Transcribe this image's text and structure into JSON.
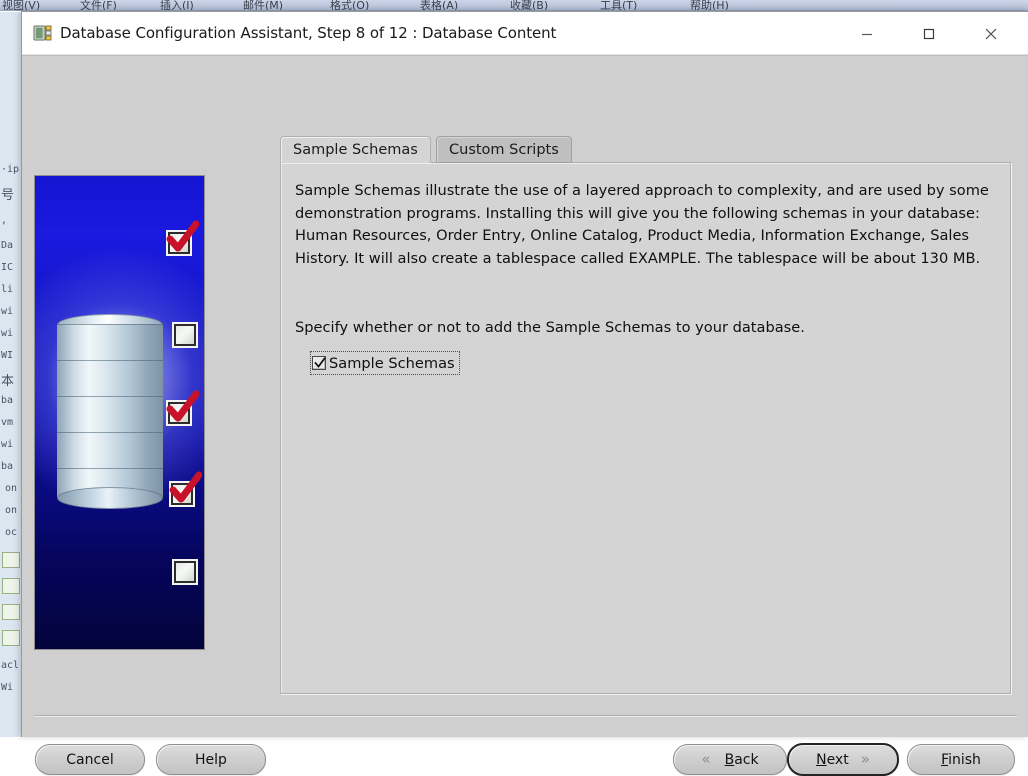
{
  "background_app": {
    "menubar": [
      "视图(V)",
      "文件(F)",
      "插入(I)",
      "邮件(M)",
      "格式(O)",
      "表格(A)",
      "收藏(B)",
      "工具(T)",
      "帮助(H)"
    ],
    "document_fragments": [
      "·ip",
      "号",
      ",",
      "Da",
      "IC",
      "li",
      "wi",
      "wi",
      "WI",
      "本",
      "ba",
      "vm",
      "wi",
      "ba",
      "on",
      "on",
      "oc",
      "acl",
      "Wi"
    ]
  },
  "window": {
    "icon": "database-icon",
    "title": "Database Configuration Assistant, Step 8 of 12 : Database Content",
    "controls": {
      "minimize": "minimize-icon",
      "maximize": "maximize-icon",
      "close": "close-icon"
    }
  },
  "splash": {
    "name": "oracle-database-splash",
    "checkbox_states": [
      "checked",
      "unchecked",
      "checked",
      "checked",
      "unchecked"
    ]
  },
  "tabs": [
    {
      "label": "Sample Schemas",
      "active": true
    },
    {
      "label": "Custom Scripts",
      "active": false
    }
  ],
  "panel": {
    "description": "Sample Schemas illustrate the use of a layered approach to complexity, and are used by some demonstration programs. Installing this will give you the following schemas in your database: Human Resources, Order Entry, Online Catalog, Product Media, Information Exchange, Sales History. It will also create a tablespace called EXAMPLE. The tablespace will be about 130 MB.",
    "specify_text": "Specify whether or not to add the Sample Schemas to your database.",
    "checkbox": {
      "label": "Sample Schemas",
      "checked": true
    }
  },
  "buttons": {
    "cancel": "Cancel",
    "help": "Help",
    "back": {
      "label": "Back",
      "mnemonic": "B",
      "rest": "ack",
      "arrow": "«"
    },
    "next": {
      "label": "Next",
      "mnemonic": "N",
      "rest": "ext",
      "arrow": "»",
      "is_default": true
    },
    "finish": {
      "label": "Finish",
      "mnemonic": "F",
      "rest": "inish"
    }
  },
  "colors": {
    "dialog_background": "#cfcfcf",
    "panel_background": "#d4d4d4",
    "titlebar_background": "#ffffff",
    "splash_blue": "#1414d2",
    "checkmark_red": "#c8122a"
  }
}
